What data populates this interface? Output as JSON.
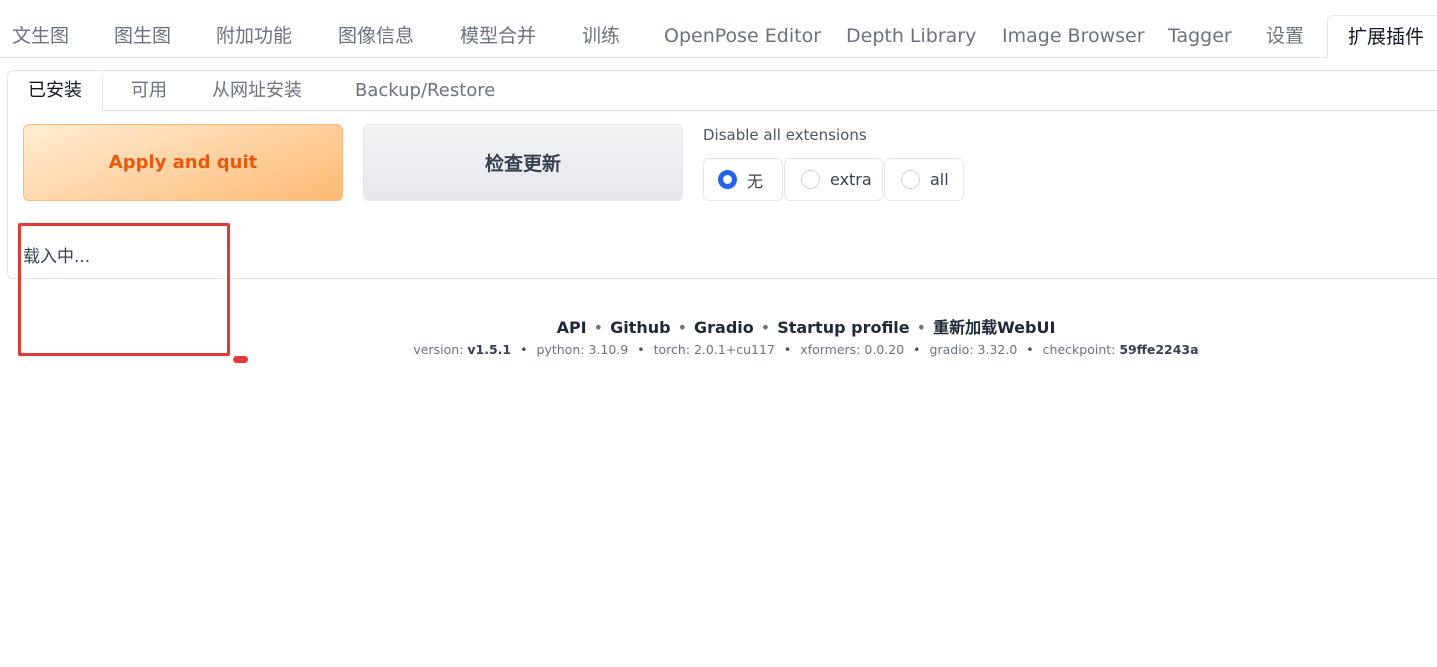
{
  "top_tabs": [
    "文生图",
    "图生图",
    "附加功能",
    "图像信息",
    "模型合并",
    "训练",
    "OpenPose Editor",
    "Depth Library",
    "Image Browser",
    "Tagger",
    "设置",
    "扩展插件"
  ],
  "active_top_tab": "扩展插件",
  "sub_tabs": [
    "已安装",
    "可用",
    "从网址安装",
    "Backup/Restore"
  ],
  "active_sub_tab": "已安装",
  "buttons": {
    "apply": "Apply and quit",
    "check_updates": "检查更新"
  },
  "disable_extensions": {
    "label": "Disable all extensions",
    "options": [
      "无",
      "extra",
      "all"
    ],
    "selected": "无"
  },
  "loading_text": "载入中...",
  "footer": {
    "links": [
      "API",
      "Github",
      "Gradio",
      "Startup profile",
      "重新加载WebUI"
    ],
    "separator": "•",
    "info": [
      {
        "label": "version:",
        "value": "v1.5.1"
      },
      {
        "label": "python:",
        "value": "3.10.9"
      },
      {
        "label": "torch:",
        "value": "2.0.1+cu117"
      },
      {
        "label": "xformers:",
        "value": "0.0.20"
      },
      {
        "label": "gradio:",
        "value": "3.32.0"
      },
      {
        "label": "checkpoint:",
        "value": "59ffe2243a"
      }
    ]
  },
  "colors": {
    "accent": "#2563eb",
    "primary_text": "#ea580c",
    "annotation": "#e53935"
  }
}
